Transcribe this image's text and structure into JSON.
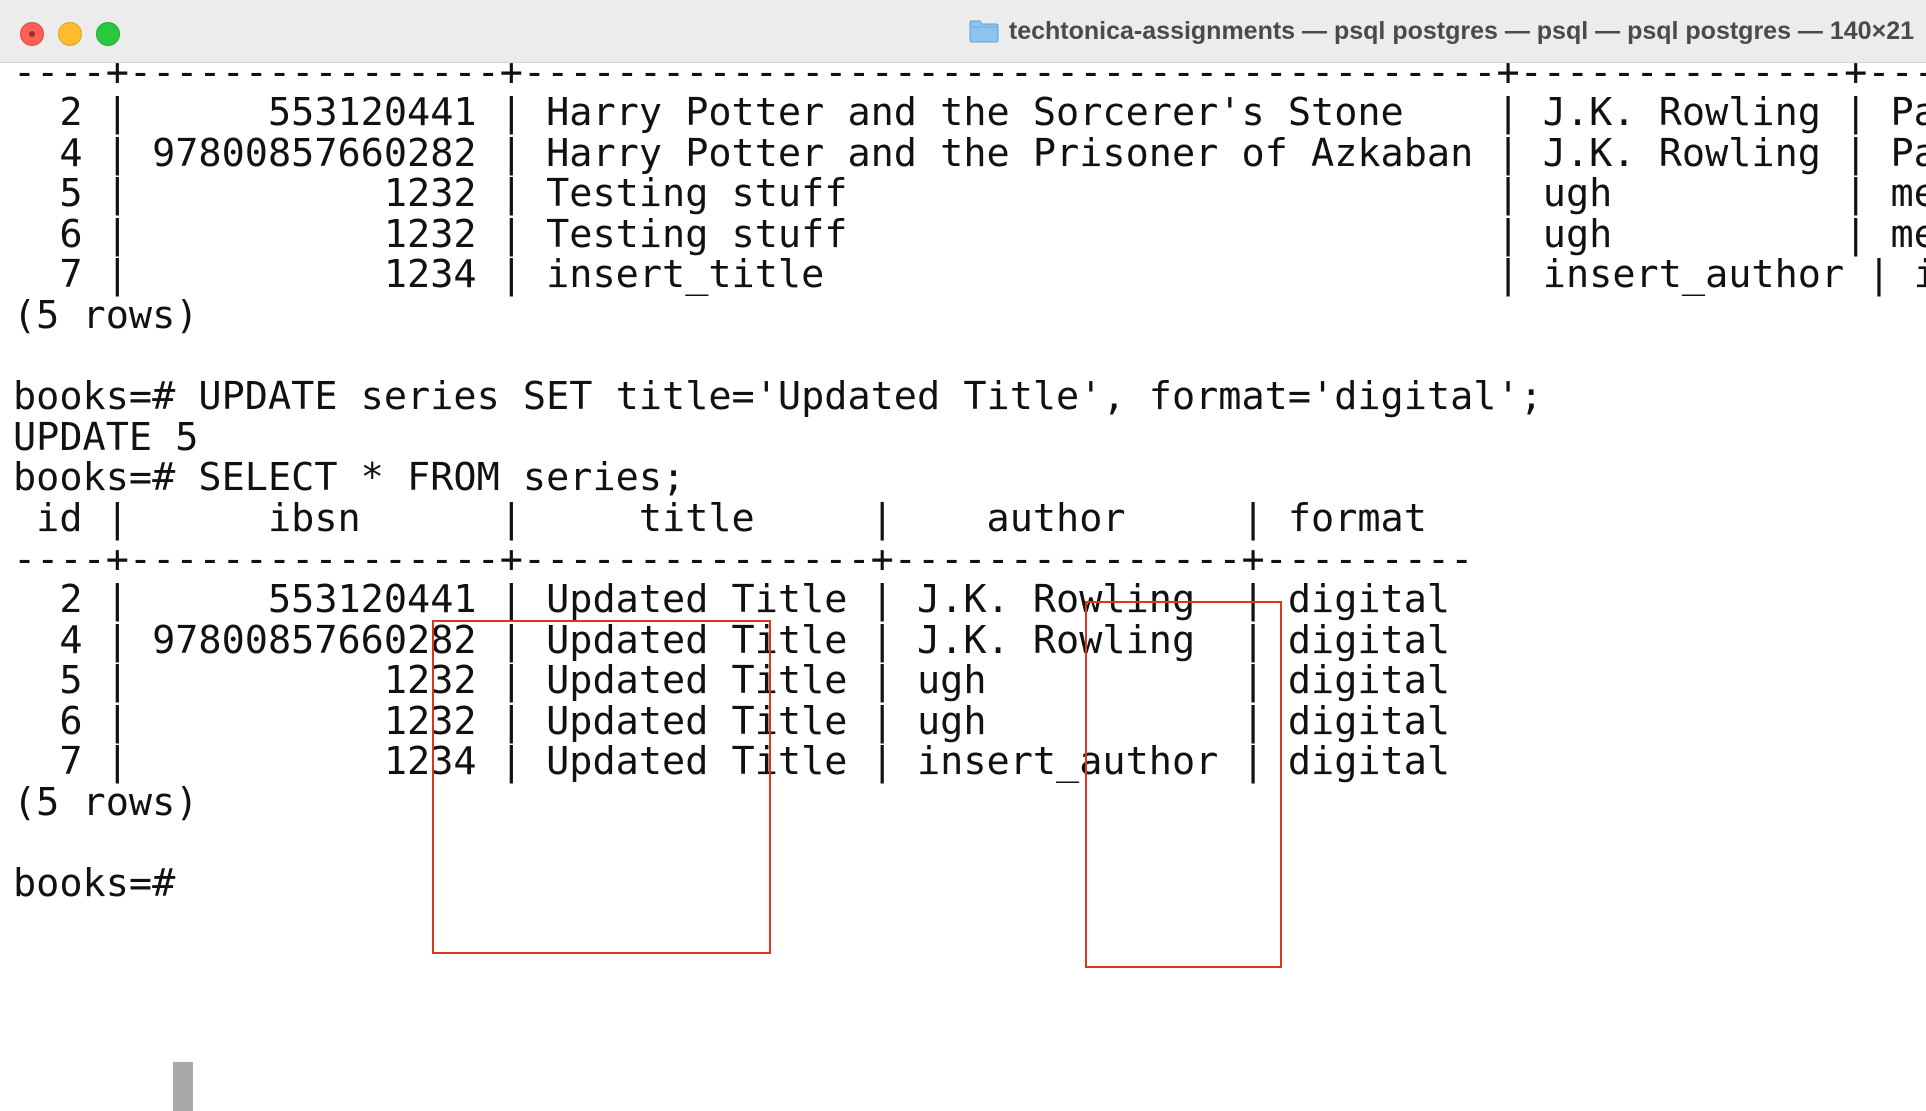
{
  "window": {
    "title": "techtonica-assignments — psql postgres — psql — psql postgres — 140×21",
    "folder_icon": "folder-icon",
    "controls": [
      "close-icon",
      "minimize-icon",
      "maximize-icon"
    ]
  },
  "terminal": {
    "lines": [
      "----+----------------+------------------------------------------+--------------+----------------",
      "  2 |      553120441 | Harry Potter and the Sorcerer's Stone    | J.K. Rowling | Paperback",
      "  4 | 97800857660282 | Harry Potter and the Prisoner of Azkaban | J.K. Rowling | Paperback",
      "  5 |           1232 | Testing stuff                            | ugh          | meeee",
      "  6 |           1232 | Testing stuff                            | ugh          | meeee",
      "  7 |           1234 | insert_title                             | insert_author | insert_format",
      "(5 rows)",
      "",
      "books=# UPDATE series SET title='Updated Title', format='digital';",
      "UPDATE 5",
      "books=# SELECT * FROM series;",
      " id |      ibsn      |     title     |    author     | format",
      "----+----------------+---------------+---------------+---------",
      "  2 |      553120441 | Updated Title | J.K. Rowling  | digital",
      "  4 | 97800857660282 | Updated Title | J.K. Rowling  | digital",
      "  5 |           1232 | Updated Title | ugh           | digital",
      "  6 |           1232 | Updated Title | ugh           | digital",
      "  7 |           1234 | Updated Title | insert_author | digital",
      "(5 rows)",
      "",
      "books=# "
    ],
    "prompt": "books=# ",
    "highlight_color": "#d9381e",
    "cursor_color": "#a9a9a9"
  }
}
